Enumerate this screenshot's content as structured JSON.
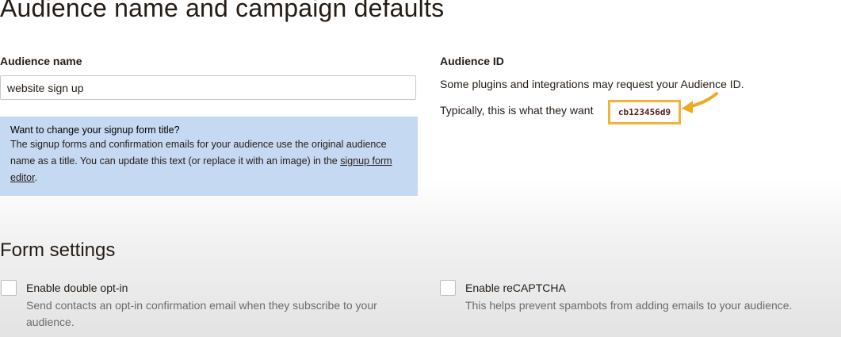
{
  "header": {
    "title": "Audience name and campaign defaults"
  },
  "audience_name": {
    "label": "Audience name",
    "value": "website sign up"
  },
  "notice": {
    "title": "Want to change your signup form title?",
    "body": "The signup forms and confirmation emails for your audience use the original audience name as a title. You can update this text (or replace it with an image) in the",
    "link": "signup form editor",
    "end": "."
  },
  "audience_id": {
    "label": "Audience ID",
    "description": "Some plugins and integrations may request your Audience ID.",
    "hint": "Typically, this is what they want",
    "value": "cb123456d9"
  },
  "form_settings": {
    "title": "Form settings",
    "double_optin": {
      "label": "Enable double opt-in",
      "description": "Send contacts an opt-in confirmation email when they subscribe to your audience.",
      "checked": false
    },
    "recaptcha": {
      "label": "Enable reCAPTCHA",
      "description": "This helps prevent spambots from adding emails to your audience.",
      "checked": false
    }
  },
  "colors": {
    "notice_bg": "#c6d9f3",
    "highlight": "#f2b33d",
    "text": "#241c15"
  },
  "icons": [
    "arrow-icon"
  ]
}
